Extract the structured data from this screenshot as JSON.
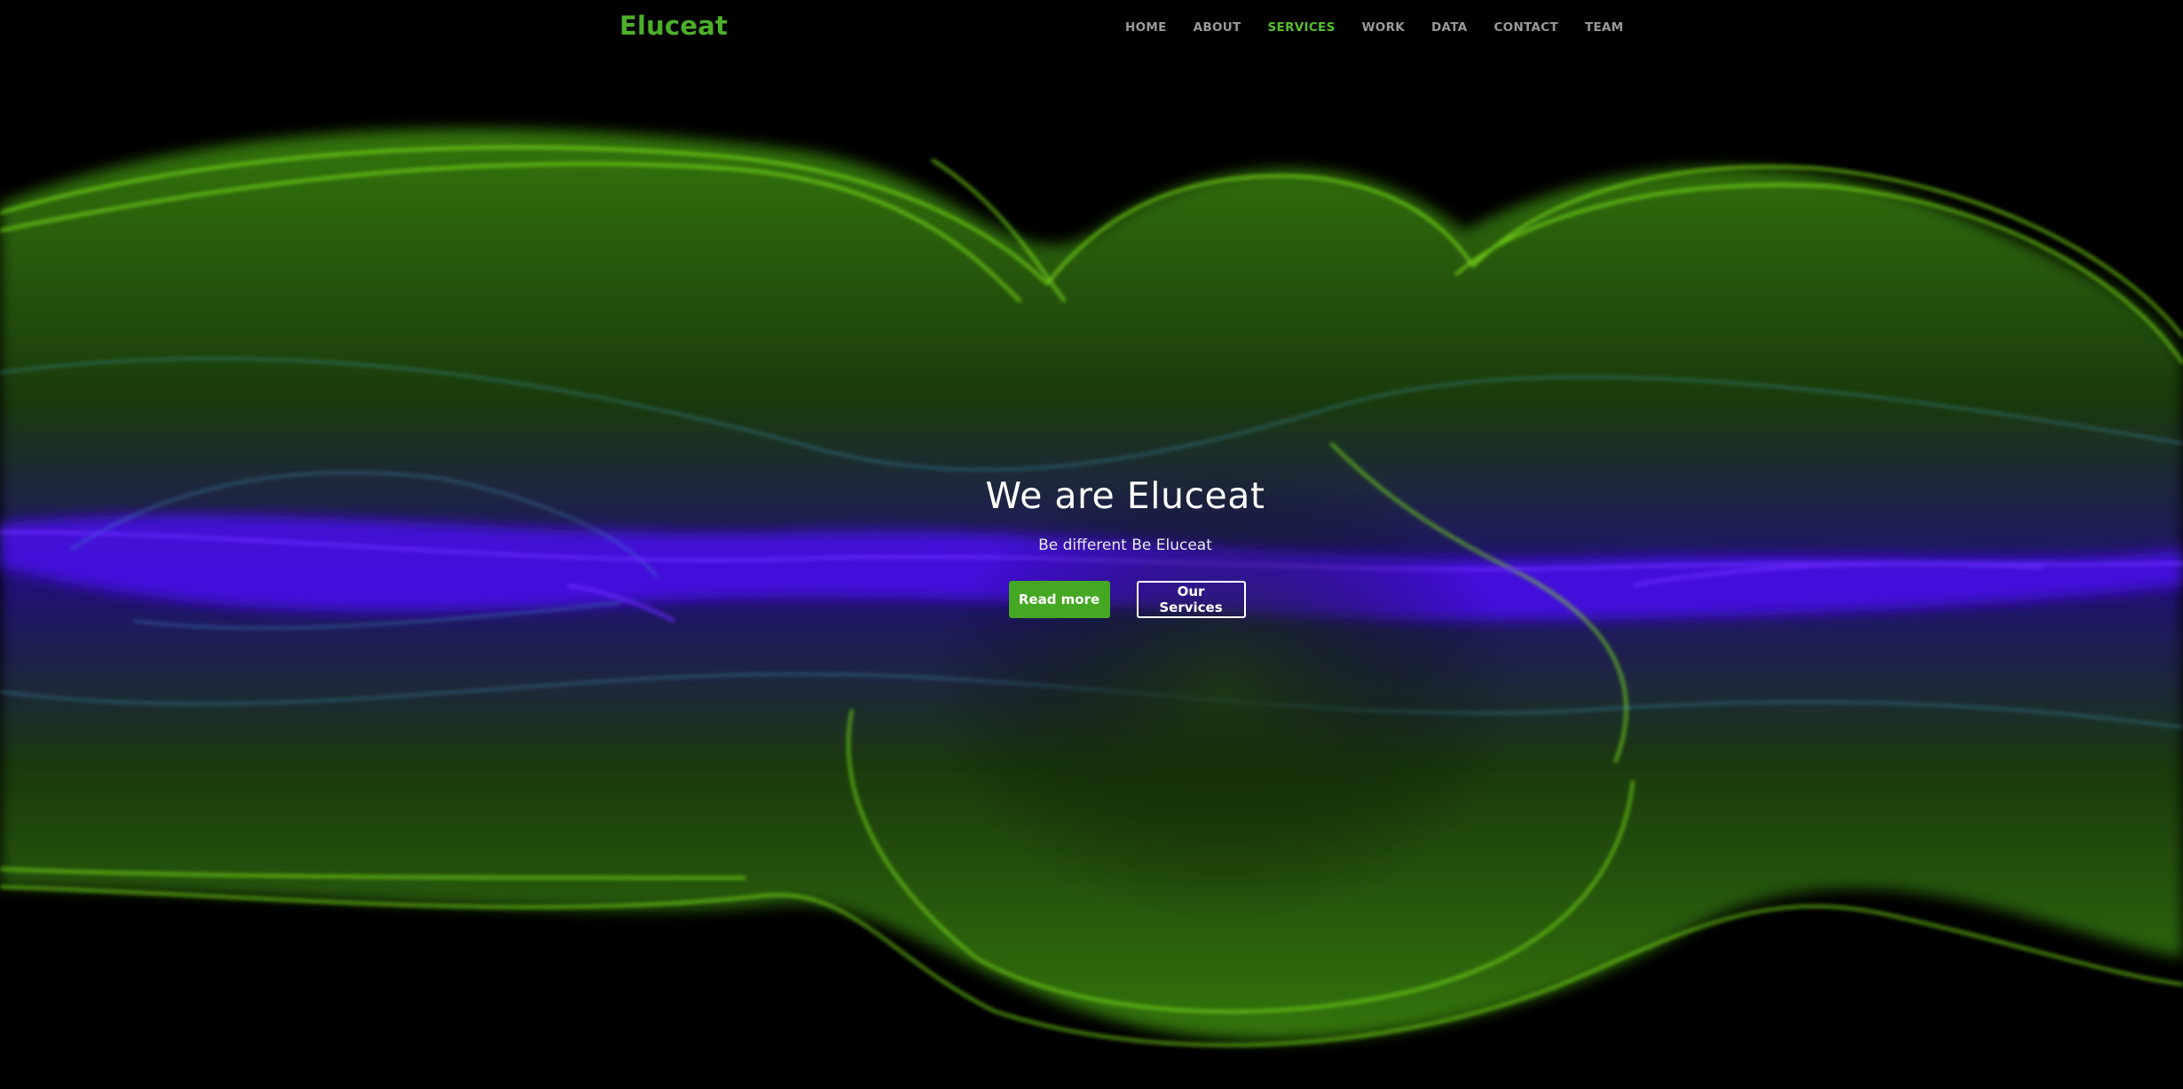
{
  "nav": {
    "brand": "Eluceat",
    "items": [
      {
        "label": "HOME"
      },
      {
        "label": "ABOUT"
      },
      {
        "label": "SERVICES"
      },
      {
        "label": "WORK"
      },
      {
        "label": "DATA"
      },
      {
        "label": "CONTACT"
      },
      {
        "label": "TEAM"
      }
    ],
    "active": "SERVICES"
  },
  "hero": {
    "title": "We are Eluceat",
    "subtitle": "Be different Be Eluceat",
    "primary_button": "Read more",
    "secondary_button": "Our Services"
  },
  "colors": {
    "background": "#000000",
    "brand_green": "#4caf2a",
    "accent_green": "#55c12c",
    "wave_green": "#7be81e",
    "wave_violet": "#4a10ff",
    "nav_text": "#9a9a9a"
  }
}
